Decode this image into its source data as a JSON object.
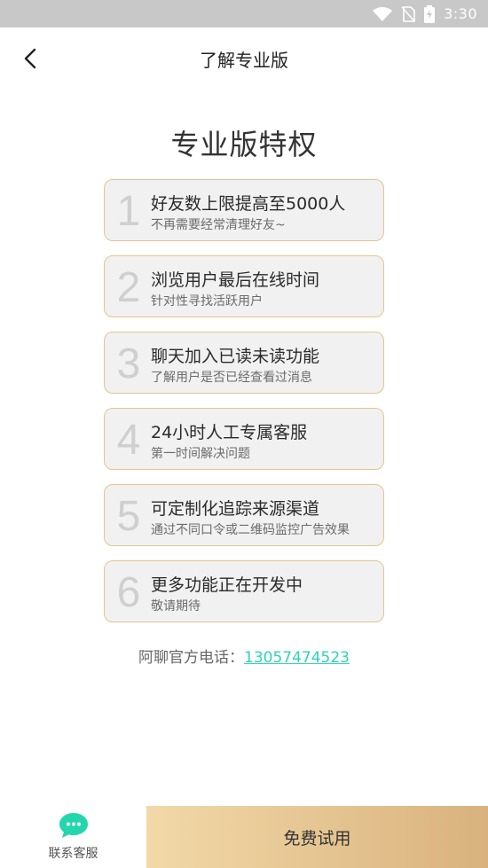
{
  "status_bar": {
    "time": "3:30",
    "icons": [
      "wifi-icon",
      "no-sim-icon",
      "battery-charging-icon"
    ]
  },
  "header": {
    "back_icon": "chevron-left-icon",
    "title": "了解专业版"
  },
  "main": {
    "title": "专业版特权",
    "features": [
      {
        "number": "1",
        "title": "好友数上限提高至5000人",
        "desc": "不再需要经常清理好友~"
      },
      {
        "number": "2",
        "title": "浏览用户最后在线时间",
        "desc": "针对性寻找活跃用户"
      },
      {
        "number": "3",
        "title": "聊天加入已读未读功能",
        "desc": "了解用户是否已经查看过消息"
      },
      {
        "number": "4",
        "title": "24小时人工专属客服",
        "desc": "第一时间解决问题"
      },
      {
        "number": "5",
        "title": "可定制化追踪来源渠道",
        "desc": "通过不同口令或二维码监控广告效果"
      },
      {
        "number": "6",
        "title": "更多功能正在开发中",
        "desc": "敬请期待"
      }
    ],
    "phone_label": "阿聊官方电话：",
    "phone_number": "13057474523"
  },
  "bottom_bar": {
    "contact_icon": "chat-bubble-icon",
    "contact_label": "联系客服",
    "trial_label": "免费试用"
  },
  "colors": {
    "status_bar": "#c8c8c8",
    "card_border": "#e5c48f",
    "card_bg": "#f1f1f1",
    "link": "#2fd3b8",
    "chat_icon": "#23d6ae",
    "trial_gradient_start": "#f2d9a8",
    "trial_gradient_end": "#d9b27d"
  }
}
